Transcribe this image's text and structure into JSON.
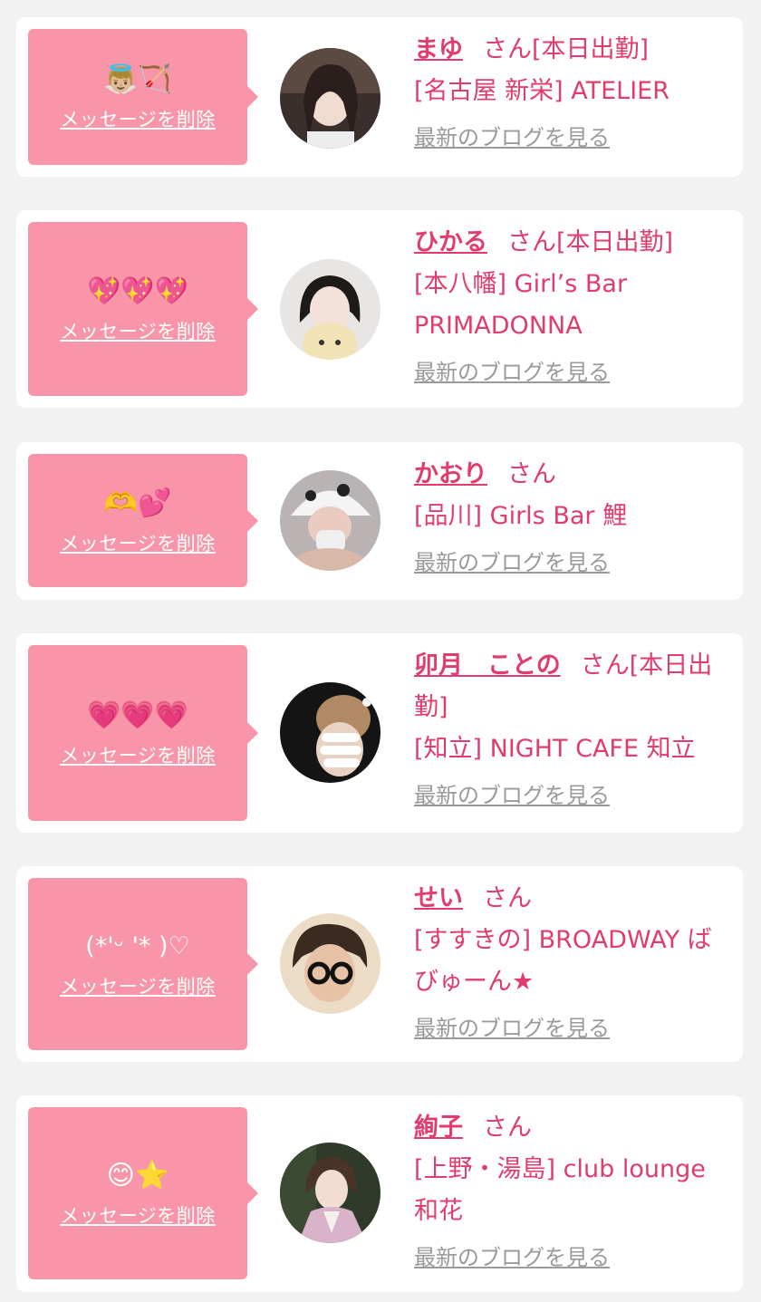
{
  "delete_label": "メッセージを削除",
  "blog_label": "最新のブログを見る",
  "colors": {
    "accent": "#e03c6d",
    "bubble": "#f895a8",
    "muted": "#9a9a9a",
    "background": "#f2f2f2"
  },
  "entries": [
    {
      "stamp": "👼🏼🏹",
      "name": "まゆ",
      "suffix": "さん[本日出勤]",
      "shop": "[名古屋 新栄] ATELIER"
    },
    {
      "stamp": "💖💖💖",
      "name": "ひかる",
      "suffix": "さん[本日出勤]",
      "shop": "[本八幡] Girl’s Bar PRIMADONNA"
    },
    {
      "stamp": "🫶💕",
      "name": "かおり",
      "suffix": "さん",
      "shop": "[品川] Girls Bar 鯉"
    },
    {
      "stamp": "💗💗💗",
      "name": "卯月　ことの",
      "suffix": "さん[本日出勤]",
      "shop": "[知立] NIGHT CAFE 知立"
    },
    {
      "stamp": "(*'ᵕ '* )♡",
      "name": "せい",
      "suffix": "さん",
      "shop": "[すすきの] BROADWAY ばびゅーん★"
    },
    {
      "stamp": "😊⭐️",
      "name": "絢子",
      "suffix": "さん",
      "shop": "[上野・湯島] club lounge 和花"
    }
  ]
}
